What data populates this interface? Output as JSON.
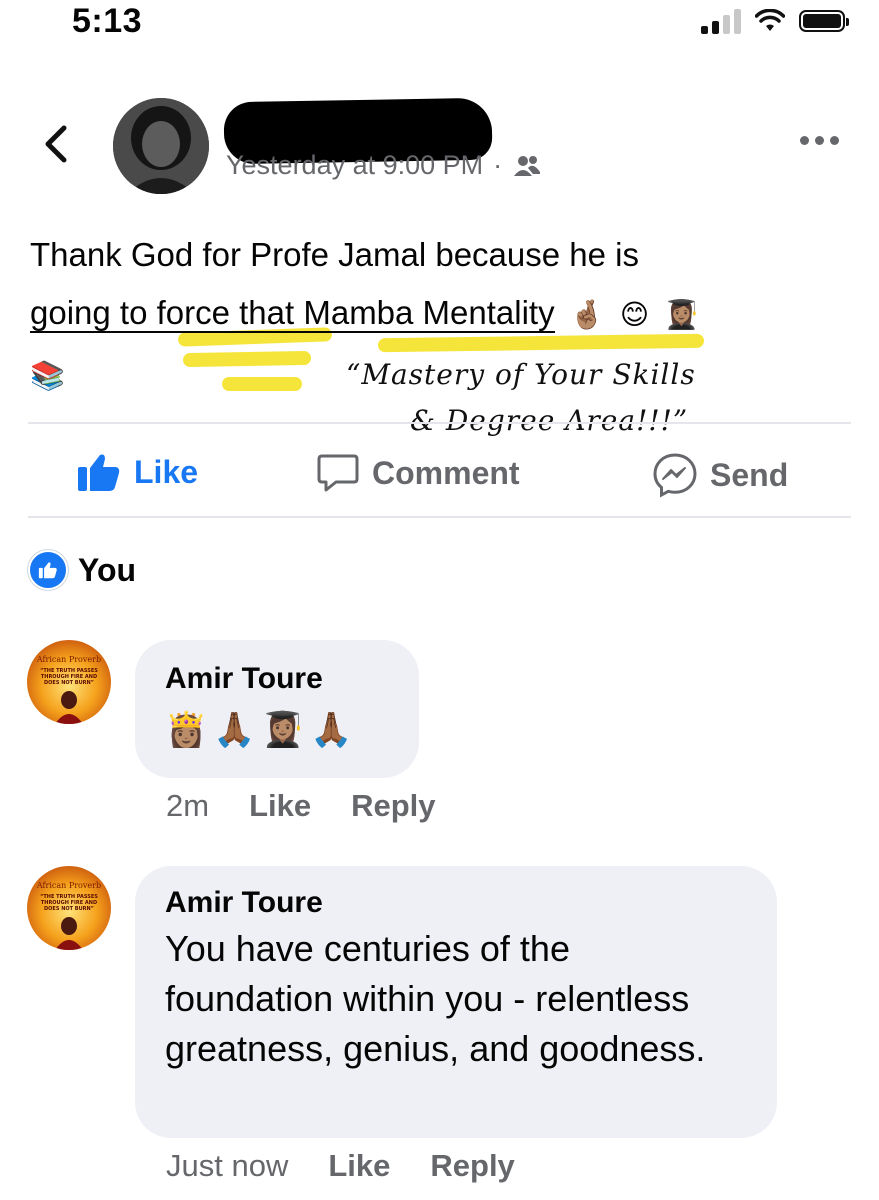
{
  "status_bar": {
    "time": "5:13"
  },
  "post": {
    "timestamp": "Yesterday at 9:00 PM",
    "separator": "·",
    "audience_icon": "friends-icon",
    "text_line1": "Thank God for Profe Jamal because he is",
    "text_line2": "going to force that Mamba Mentality",
    "emojis_line2": [
      "🤞🏽",
      "😊",
      "👩🏽‍🎓"
    ],
    "emojis_line3": [
      "📚"
    ],
    "annotation_line1": "“Mastery of Your Skills",
    "annotation_line2": "& Degree Area!!!”"
  },
  "actions": {
    "like": "Like",
    "comment": "Comment",
    "send": "Send"
  },
  "reactions": {
    "label": "You"
  },
  "comment_avatar_text": {
    "title": "African Proverb",
    "quote": "“THE TRUTH PASSES THROUGH FIRE AND DOES NOT BURN”"
  },
  "comments": [
    {
      "author": "Amir Toure",
      "emojis": [
        "👸🏽",
        "🙏🏾",
        "👩🏽‍🎓",
        "🙏🏾"
      ],
      "time": "2m",
      "like": "Like",
      "reply": "Reply"
    },
    {
      "author": "Amir Toure",
      "text": "You have centuries of the foundation within you - relentless greatness, genius, and goodness.",
      "time": "Just now",
      "like": "Like",
      "reply": "Reply"
    }
  ],
  "colors": {
    "accent": "#1877f2",
    "meta_gray": "#65676b",
    "bubble": "#eff0f5",
    "highlight": "#f4e32a"
  }
}
